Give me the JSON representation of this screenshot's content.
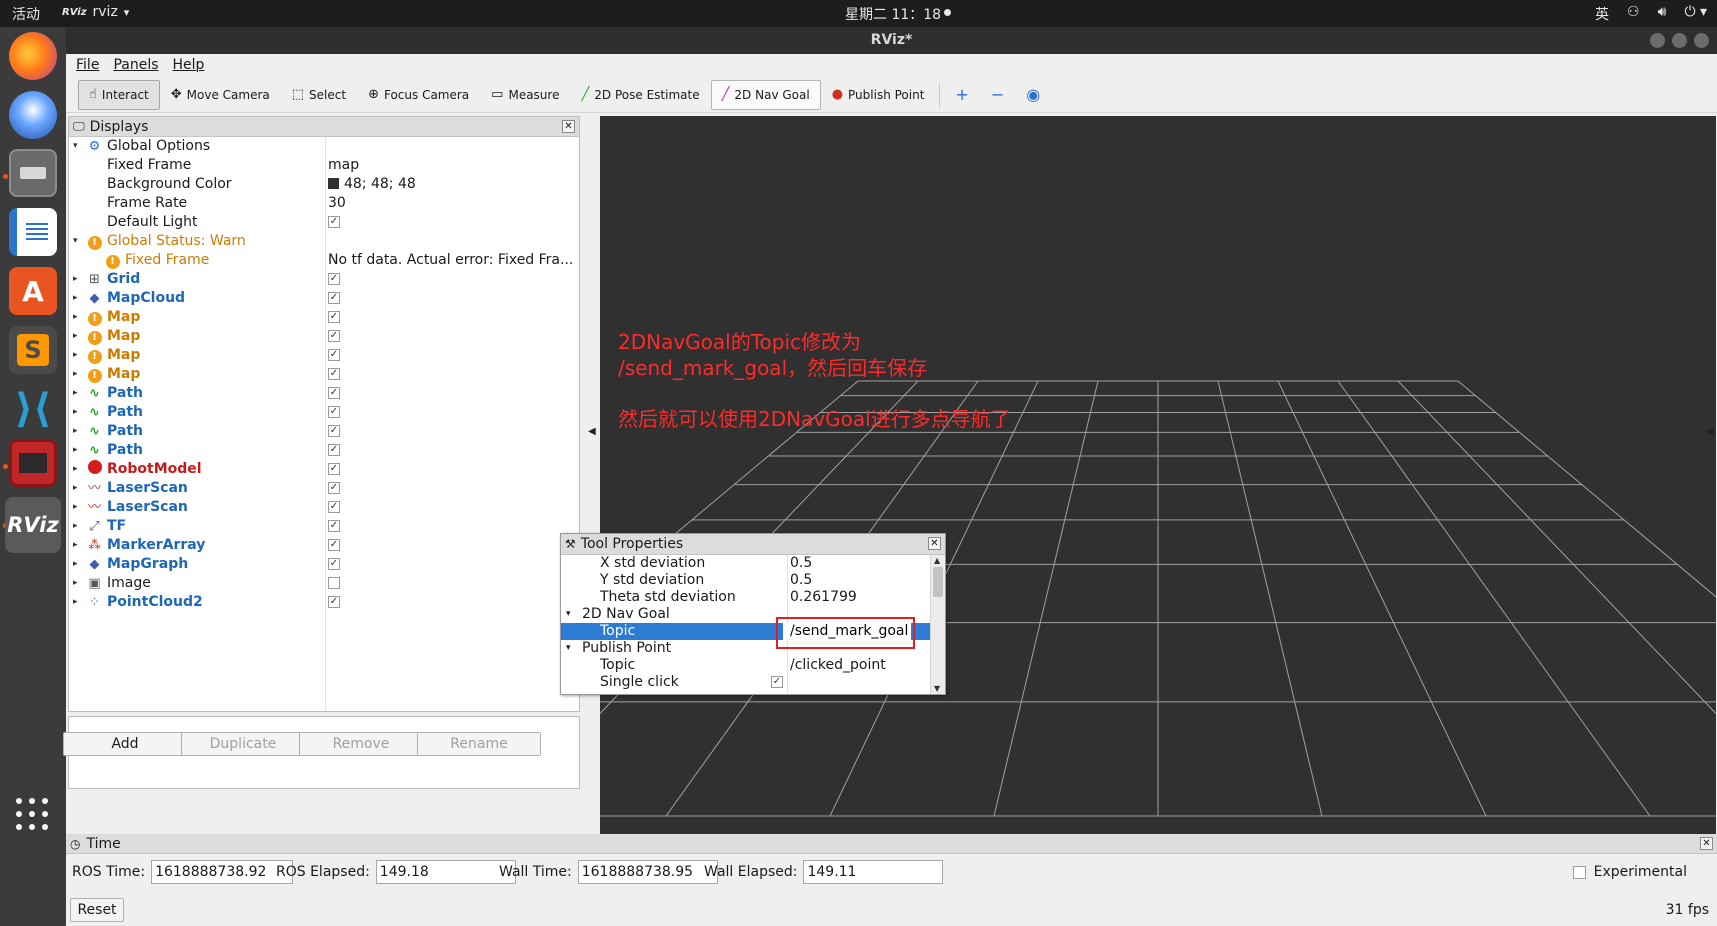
{
  "topbar": {
    "activities": "活动",
    "app_icon": "RViz",
    "app_name": "rviz",
    "app_caret": "▾",
    "clock": "星期二 11：18",
    "input_method": "英",
    "tray_icons": [
      "network-icon",
      "volume-icon",
      "power-icon"
    ]
  },
  "dock": {
    "items": [
      {
        "name": "firefox",
        "icon": "firefox-icon",
        "color": "#e66000"
      },
      {
        "name": "thunderbird",
        "icon": "thunderbird-icon",
        "color": "#2a6fd4"
      },
      {
        "name": "files",
        "icon": "files-icon",
        "color": "#6b6b6b"
      },
      {
        "name": "writer",
        "icon": "writer-icon",
        "color": "#2a74c7"
      },
      {
        "name": "software",
        "icon": "software-icon",
        "color": "#e95420"
      },
      {
        "name": "sublime",
        "icon": "sublime-icon",
        "color": "#474747"
      },
      {
        "name": "vscode",
        "icon": "vscode-icon",
        "color": "#2a9fd6"
      },
      {
        "name": "terminal",
        "icon": "terminal-icon",
        "color": "#b31b1b"
      },
      {
        "name": "rviz",
        "icon": "rviz-icon",
        "color": "#5a5a5a",
        "label": "RViz"
      }
    ],
    "apps_grid": "show-apps-icon"
  },
  "window": {
    "title": "RViz*"
  },
  "menubar": [
    "File",
    "Panels",
    "Help"
  ],
  "toolbar": [
    {
      "label": "Interact",
      "icon": "hand-icon",
      "glyph": "☝",
      "state": "active"
    },
    {
      "label": "Move Camera",
      "icon": "move-camera-icon",
      "glyph": "✥"
    },
    {
      "label": "Select",
      "icon": "select-icon",
      "glyph": "⬚"
    },
    {
      "label": "Focus Camera",
      "icon": "focus-camera-icon",
      "glyph": "⊕"
    },
    {
      "label": "Measure",
      "icon": "measure-icon",
      "glyph": "▭"
    },
    {
      "label": "2D Pose Estimate",
      "icon": "pose-estimate-icon",
      "glyph": "╱",
      "color": "#1fa81f"
    },
    {
      "label": "2D Nav Goal",
      "icon": "nav-goal-icon",
      "glyph": "╱",
      "color": "#d41fb0",
      "state": "pressed"
    },
    {
      "label": "Publish Point",
      "icon": "publish-point-icon",
      "glyph": "●",
      "color": "#cc3322"
    }
  ],
  "toolbar_extra": [
    {
      "icon": "add-tool-icon",
      "glyph": "+"
    },
    {
      "icon": "remove-tool-icon",
      "glyph": "−"
    },
    {
      "icon": "view-icon",
      "glyph": "◉"
    }
  ],
  "displays": {
    "title": "Displays",
    "rows": [
      {
        "indent": 0,
        "arrow": "▾",
        "icon": "globe-icon",
        "label": "Global Options",
        "style": "plain"
      },
      {
        "indent": 1,
        "label": "Fixed Frame",
        "value": "map",
        "style": "plain"
      },
      {
        "indent": 1,
        "label": "Background Color",
        "value": "48; 48; 48",
        "swatch": true,
        "style": "plain"
      },
      {
        "indent": 1,
        "label": "Frame Rate",
        "value": "30",
        "style": "plain"
      },
      {
        "indent": 1,
        "label": "Default Light",
        "check": true,
        "style": "plain"
      },
      {
        "indent": 0,
        "arrow": "▾",
        "icon": "warn-icon",
        "label": "Global Status: Warn",
        "style": "warn"
      },
      {
        "indent": 1,
        "icon": "warn-icon",
        "label": "Fixed Frame",
        "value": "No tf data.  Actual error: Fixed Fra...",
        "style": "warn"
      },
      {
        "indent": 0,
        "arrow": "▸",
        "icon": "grid-icon",
        "label": "Grid",
        "check": true,
        "style": "blue"
      },
      {
        "indent": 0,
        "arrow": "▸",
        "icon": "mapcloud-icon",
        "label": "MapCloud",
        "check": true,
        "style": "blue"
      },
      {
        "indent": 0,
        "arrow": "▸",
        "icon": "warn-icon",
        "label": "Map",
        "check": true,
        "style": "warnb"
      },
      {
        "indent": 0,
        "arrow": "▸",
        "icon": "warn-icon",
        "label": "Map",
        "check": true,
        "style": "warnb"
      },
      {
        "indent": 0,
        "arrow": "▸",
        "icon": "warn-icon",
        "label": "Map",
        "check": true,
        "style": "warnb"
      },
      {
        "indent": 0,
        "arrow": "▸",
        "icon": "warn-icon",
        "label": "Map",
        "check": true,
        "style": "warnb"
      },
      {
        "indent": 0,
        "arrow": "▸",
        "icon": "path-icon",
        "label": "Path",
        "check": true,
        "style": "blue"
      },
      {
        "indent": 0,
        "arrow": "▸",
        "icon": "path-icon",
        "label": "Path",
        "check": true,
        "style": "blue"
      },
      {
        "indent": 0,
        "arrow": "▸",
        "icon": "path-icon",
        "label": "Path",
        "check": true,
        "style": "blue"
      },
      {
        "indent": 0,
        "arrow": "▸",
        "icon": "path-icon",
        "label": "Path",
        "check": true,
        "style": "blue"
      },
      {
        "indent": 0,
        "arrow": "▸",
        "icon": "error-icon",
        "label": "RobotModel",
        "check": true,
        "style": "err"
      },
      {
        "indent": 0,
        "arrow": "▸",
        "icon": "laserscan-icon",
        "label": "LaserScan",
        "check": true,
        "style": "blue"
      },
      {
        "indent": 0,
        "arrow": "▸",
        "icon": "laserscan-icon",
        "label": "LaserScan",
        "check": true,
        "style": "blue"
      },
      {
        "indent": 0,
        "arrow": "▸",
        "icon": "tf-icon",
        "label": "TF",
        "check": true,
        "style": "blue"
      },
      {
        "indent": 0,
        "arrow": "▸",
        "icon": "markerarray-icon",
        "label": "MarkerArray",
        "check": true,
        "style": "blue"
      },
      {
        "indent": 0,
        "arrow": "▸",
        "icon": "mapgraph-icon",
        "label": "MapGraph",
        "check": true,
        "style": "blue"
      },
      {
        "indent": 0,
        "arrow": "▸",
        "icon": "image-icon",
        "label": "Image",
        "check": false,
        "style": "plain"
      },
      {
        "indent": 0,
        "arrow": "▸",
        "icon": "pointcloud-icon",
        "label": "PointCloud2",
        "check": true,
        "style": "blue"
      }
    ],
    "buttons": [
      {
        "label": "Add",
        "enabled": true
      },
      {
        "label": "Duplicate",
        "enabled": false
      },
      {
        "label": "Remove",
        "enabled": false
      },
      {
        "label": "Rename",
        "enabled": false
      }
    ]
  },
  "annotation": {
    "lines": [
      "2DNavGoal的Topic修改为",
      "/send_mark_goal，然后回车保存",
      "",
      "然后就可以使用2DNavGoal进行多点导航了"
    ],
    "color": "#ff2a2a"
  },
  "tool_properties": {
    "title": "Tool Properties",
    "rows": [
      {
        "indent": 1,
        "label": "X std deviation",
        "value": "0.5"
      },
      {
        "indent": 1,
        "label": "Y std deviation",
        "value": "0.5"
      },
      {
        "indent": 1,
        "label": "Theta std deviation",
        "value": "0.261799"
      },
      {
        "indent": 0,
        "arrow": "▾",
        "label": "2D Nav Goal",
        "value": ""
      },
      {
        "indent": 1,
        "label": "Topic",
        "value": "/send_mark_goal",
        "selected": true
      },
      {
        "indent": 0,
        "arrow": "▾",
        "label": "Publish Point",
        "value": ""
      },
      {
        "indent": 1,
        "label": "Topic",
        "value": "/clicked_point"
      },
      {
        "indent": 1,
        "label": "Single click",
        "check": true
      }
    ]
  },
  "time": {
    "title": "Time",
    "fields": [
      {
        "label": "ROS Time:",
        "value": "1618888738.92"
      },
      {
        "label": "ROS Elapsed:",
        "value": "149.18"
      },
      {
        "label": "Wall Time:",
        "value": "1618888738.95"
      },
      {
        "label": "Wall Elapsed:",
        "value": "149.11"
      }
    ],
    "experimental": "Experimental",
    "reset": "Reset",
    "fps": "31 fps"
  },
  "colors": {
    "background_3d": "#303030",
    "grid_line": "#a0a0a0",
    "selection": "#2c7cd4",
    "highlight_box": "#e02020"
  }
}
